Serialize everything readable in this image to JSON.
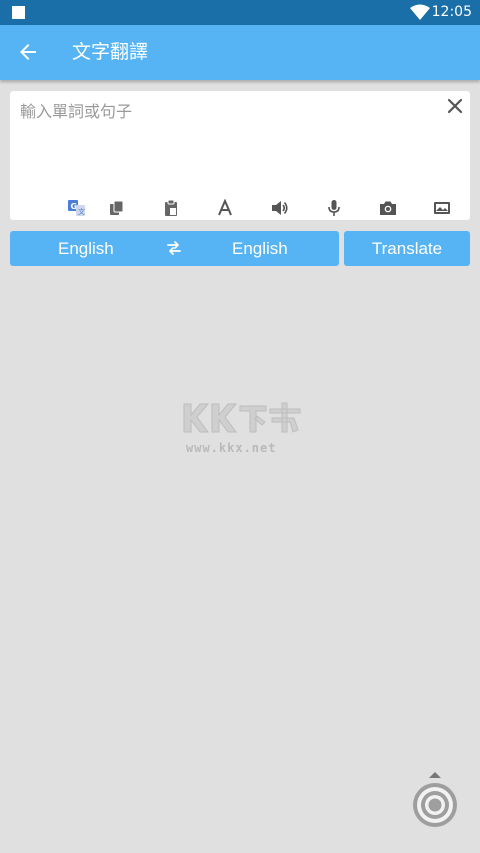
{
  "status_bar": {
    "time": "12:05",
    "icons": [
      "square-icon",
      "wifi-icon"
    ]
  },
  "app_bar": {
    "title": "文字翻譯",
    "back_icon": "arrow-left-icon"
  },
  "input": {
    "placeholder": "輸入單詞或句子",
    "value": "",
    "clear_icon": "close-icon",
    "tools": [
      "translate-icon",
      "copy-icon",
      "paste-icon",
      "font-icon",
      "speaker-icon",
      "microphone-icon",
      "camera-icon",
      "image-icon"
    ]
  },
  "language_bar": {
    "source": "English",
    "target": "English",
    "swap_icon": "swap-icon"
  },
  "translate_button": {
    "label": "Translate"
  },
  "watermark": {
    "logo_text": "KK下载",
    "url": "www.kkx.net"
  },
  "floating_button": {
    "icon": "target-icon"
  },
  "colors": {
    "status_bar": "#1b6fa8",
    "primary": "#56b4f5",
    "background": "#e0e0e0",
    "card": "#ffffff",
    "icon_gray": "#666666",
    "accent_blue": "#4a7fd9"
  }
}
